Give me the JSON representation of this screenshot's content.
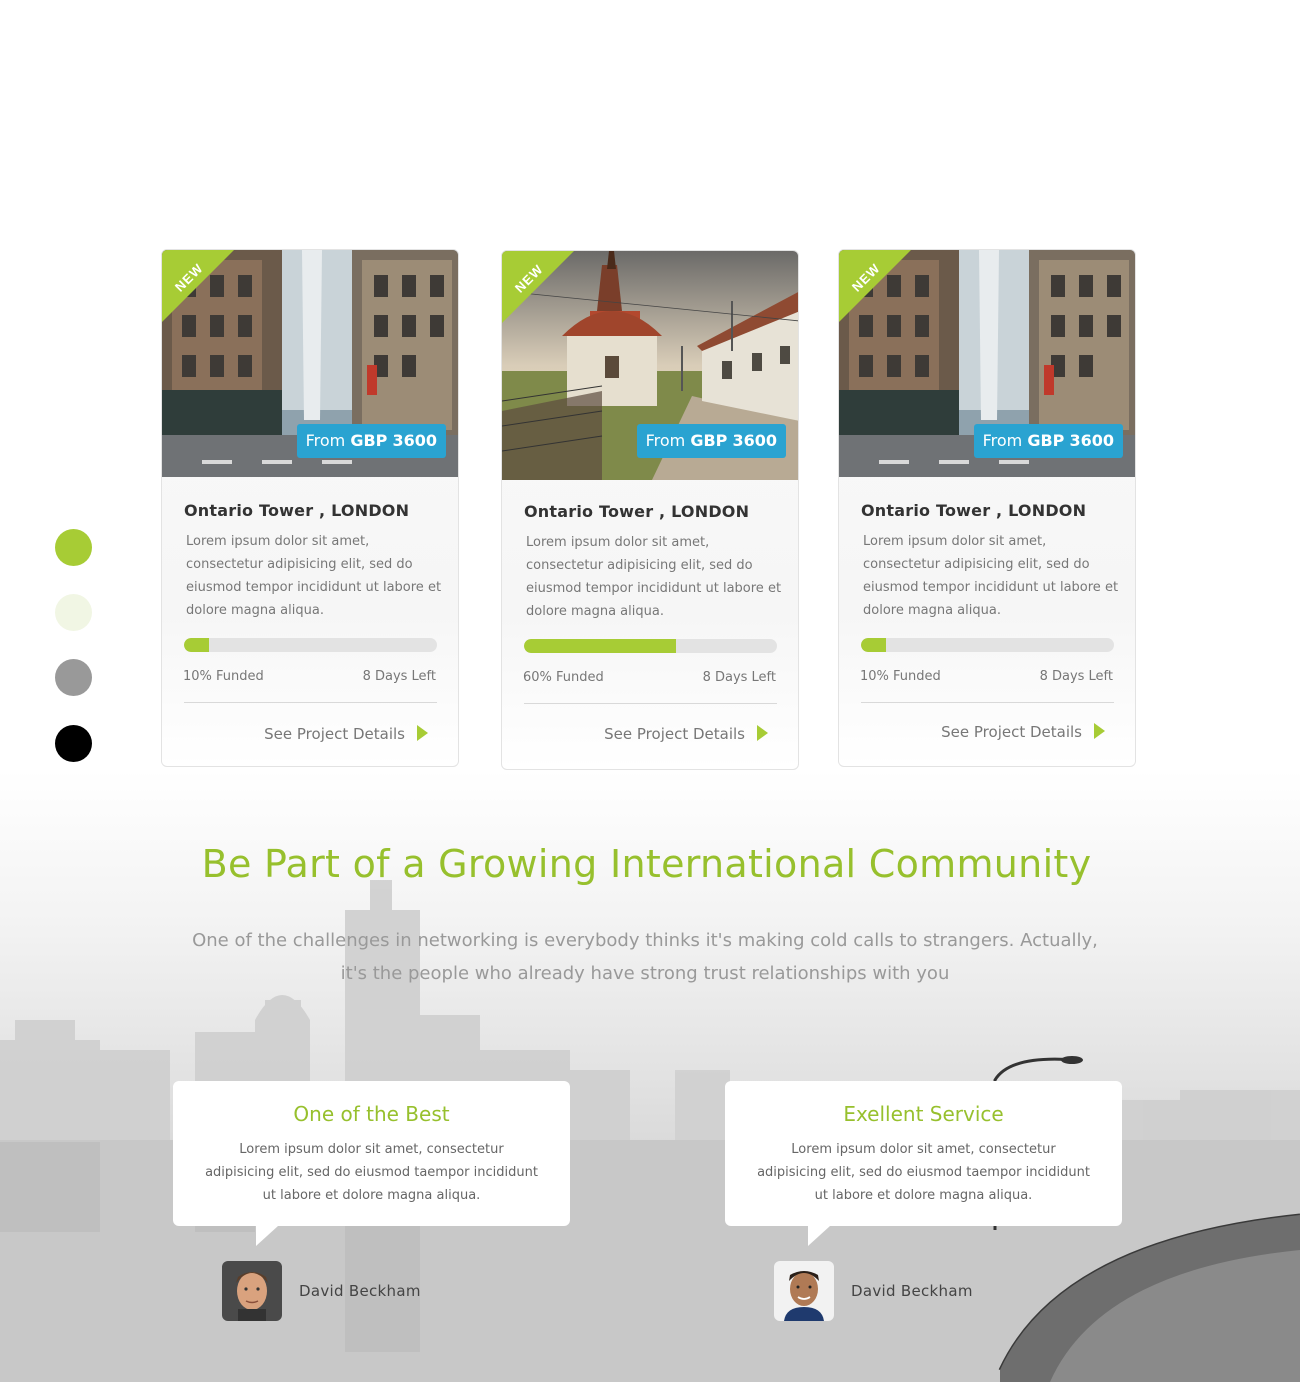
{
  "colors": {
    "accent": "#a7cc35",
    "heading_green": "#97c02d",
    "price_blue": "#2aa3d1"
  },
  "swatches": [
    {
      "name": "lime",
      "color": "#a7cc35"
    },
    {
      "name": "pale-green",
      "color": "#f1f6e4"
    },
    {
      "name": "gray",
      "color": "#999999"
    },
    {
      "name": "black",
      "color": "#000000"
    }
  ],
  "cards": [
    {
      "badge": "NEW",
      "price_prefix": "From",
      "price_currency": "GBP",
      "price_amount": "3600",
      "title": "Ontario Tower , LONDON",
      "description": "Lorem ipsum dolor sit amet, consectetur adipisicing elit, sed do eiusmod tempor incididunt ut labore et dolore magna aliqua.",
      "funded_percent": 10,
      "funded_label": "10% Funded",
      "days_left": "8 Days Left",
      "link": "See Project Details",
      "image": "city-street"
    },
    {
      "badge": "NEW",
      "price_prefix": "From",
      "price_currency": "GBP",
      "price_amount": "3600",
      "title": "Ontario Tower , LONDON",
      "description": "Lorem ipsum dolor sit amet, consectetur adipisicing elit, sed do eiusmod tempor incididunt ut labore et dolore magna aliqua.",
      "funded_percent": 60,
      "funded_label": "60% Funded",
      "days_left": "8 Days Left",
      "link": "See Project Details",
      "image": "village-church"
    },
    {
      "badge": "NEW",
      "price_prefix": "From",
      "price_currency": "GBP",
      "price_amount": "3600",
      "title": "Ontario Tower , LONDON",
      "description": "Lorem ipsum dolor sit amet, consectetur adipisicing elit, sed do eiusmod tempor incididunt ut labore et dolore magna aliqua.",
      "funded_percent": 10,
      "funded_label": "10% Funded",
      "days_left": "8 Days Left",
      "link": "See Project Details",
      "image": "city-street"
    }
  ],
  "community": {
    "title": "Be Part of a Growing International Community",
    "subtitle": "One of the challenges in networking is everybody thinks it's making cold calls to strangers. Actually, it's the people who already have strong trust relationships with you"
  },
  "testimonials": [
    {
      "title": "One of the Best",
      "text": "Lorem ipsum dolor sit amet, consectetur adipisicing elit, sed do eiusmod taempor incididunt ut labore et dolore magna aliqua.",
      "author": "David Beckham"
    },
    {
      "title": "Exellent Service",
      "text": "Lorem ipsum dolor sit amet, consectetur adipisicing elit, sed do eiusmod taempor incididunt ut labore et dolore magna aliqua.",
      "author": "David Beckham"
    }
  ]
}
